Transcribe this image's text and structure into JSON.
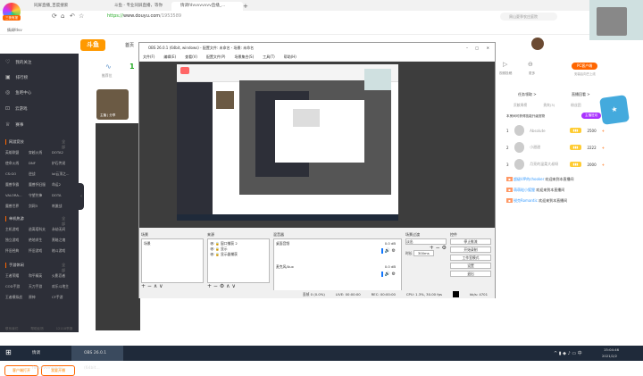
{
  "browser": {
    "tabs": [
      "同屏直播_百度搜索",
      "斗鱼 - 专业同屏直播，等你",
      "情调fdvvvvvvvv直播_..."
    ],
    "new_tab": "+",
    "url_prefix": "https://",
    "url_host": "www.douyu.com",
    "url_path": "/1953589",
    "search_placeholder": "周山夏季农庄庭院",
    "bookmark": "情调fdvv",
    "badge_360": "三夜有报"
  },
  "site": {
    "logo": "斗鱼",
    "nav_home": "首页",
    "header_icons": [
      "历史",
      "关注",
      "下载",
      "开播",
      "消息"
    ]
  },
  "sidebar": {
    "items": [
      "我的关注",
      "排行榜",
      "鱼吧中心",
      "云游戏",
      "赛事"
    ],
    "sections": [
      {
        "title": "网游竞技",
        "all": "全部",
        "games": [
          "英雄联盟",
          "穿越火线",
          "DOTA2",
          "使命火线",
          "DNF",
          "炉石传说",
          "CS:GO",
          "逆战",
          "lol云顶之...",
          "魔兽争霸",
          "魔兽怀旧服",
          "命运2",
          "VALORA...",
          "守望先锋",
          "DOTA",
          "魔兽世界",
          "剑网3",
          "刺激战"
        ]
      },
      {
        "title": "单机热游",
        "all": "全部",
        "games": [
          "主机游戏",
          "逃离塔科夫",
          "永劫无间",
          "独立游戏",
          "绝地求生",
          "黑暗之魂",
          "怀旧经典",
          "怀旧游戏",
          "格斗游戏"
        ]
      },
      {
        "title": "手游休闲",
        "all": "全部",
        "games": [
          "王者荣耀",
          "和平精英",
          "火影忍者",
          "COD手游",
          "天刀手游",
          "欢乐斗地主",
          "王者模拟战",
          "原神",
          "CF手游"
        ]
      }
    ],
    "buttons": [
      "客户端打开",
      "我要开播"
    ],
    "footer": [
      "联系我们",
      "帮助反馈",
      "12118举报"
    ]
  },
  "main": {
    "stats_label": "推荐位",
    "stats_value": "1",
    "anchor_tag": "主播 | 分享"
  },
  "obs": {
    "title": "OBS 26.0.1 (64bit, windows) - 配置文件: 未命名 - 场景: 未命名",
    "menu": [
      "文件(F)",
      "编辑(E)",
      "查看(V)",
      "配置文件(P)",
      "场景集合(S)",
      "工具(T)",
      "帮助(H)"
    ],
    "docks": {
      "scenes": {
        "title": "场景",
        "items": [
          "场景"
        ]
      },
      "sources": {
        "title": "来源",
        "items": [
          "窗口捕获 2",
          "显示",
          "显示器捕获"
        ]
      },
      "mixer": {
        "title": "混音器",
        "channels": [
          {
            "name": "桌面音频",
            "db": "0.0 dB"
          },
          {
            "name": "麦克风/Aux",
            "db": "0.0 dB"
          }
        ]
      },
      "transitions": {
        "title": "场景过渡",
        "type": "淡出",
        "duration_label": "时长",
        "duration": "300ms"
      },
      "controls": {
        "title": "控件",
        "buttons": [
          "停止推流",
          "开始录制",
          "工作室模式",
          "设置",
          "退出"
        ]
      }
    },
    "status": [
      "丢帧 0 (0.0%)",
      "LIVE: 00:00:00",
      "REC: 00:00:00",
      "CPU: 1.3%, 30.00 fps",
      "kb/s: 4701"
    ]
  },
  "right": {
    "icons": [
      "视频投稿",
      "更多"
    ],
    "pc_button": "PC客户端",
    "pc_sub": "安装后向巴上线",
    "actions": [
      "任务领取 >",
      "直播回看 >"
    ],
    "tabs": [
      "贡献周榜",
      "贵宾(3)",
      "粉丝团"
    ],
    "notice": "本房间可获得技能升级宠物",
    "promo": "主播狂欢",
    "ranking": [
      {
        "rank": "1",
        "name": "Absolute",
        "score": "2500"
      },
      {
        "rank": "2",
        "name": "小甜甜",
        "score": "2222"
      },
      {
        "rank": "3",
        "name": "月亮的温柔大叔呀",
        "score": "2000"
      }
    ],
    "chat": [
      {
        "user": "超级VIP的chooker",
        "msg": "欢迎来到本直播间"
      },
      {
        "user": "萌萌哒小狐狸",
        "msg": "欢迎来到本直播间"
      },
      {
        "user": "锐克Romantic",
        "msg": "欢迎来到本直播间"
      }
    ]
  },
  "taskbar": {
    "apps": [
      "情调fdvvvvvvvvvvv...",
      "OBS 26.0.1 (64bit..."
    ],
    "time": "15:04:46",
    "date": "2021/2/2"
  }
}
